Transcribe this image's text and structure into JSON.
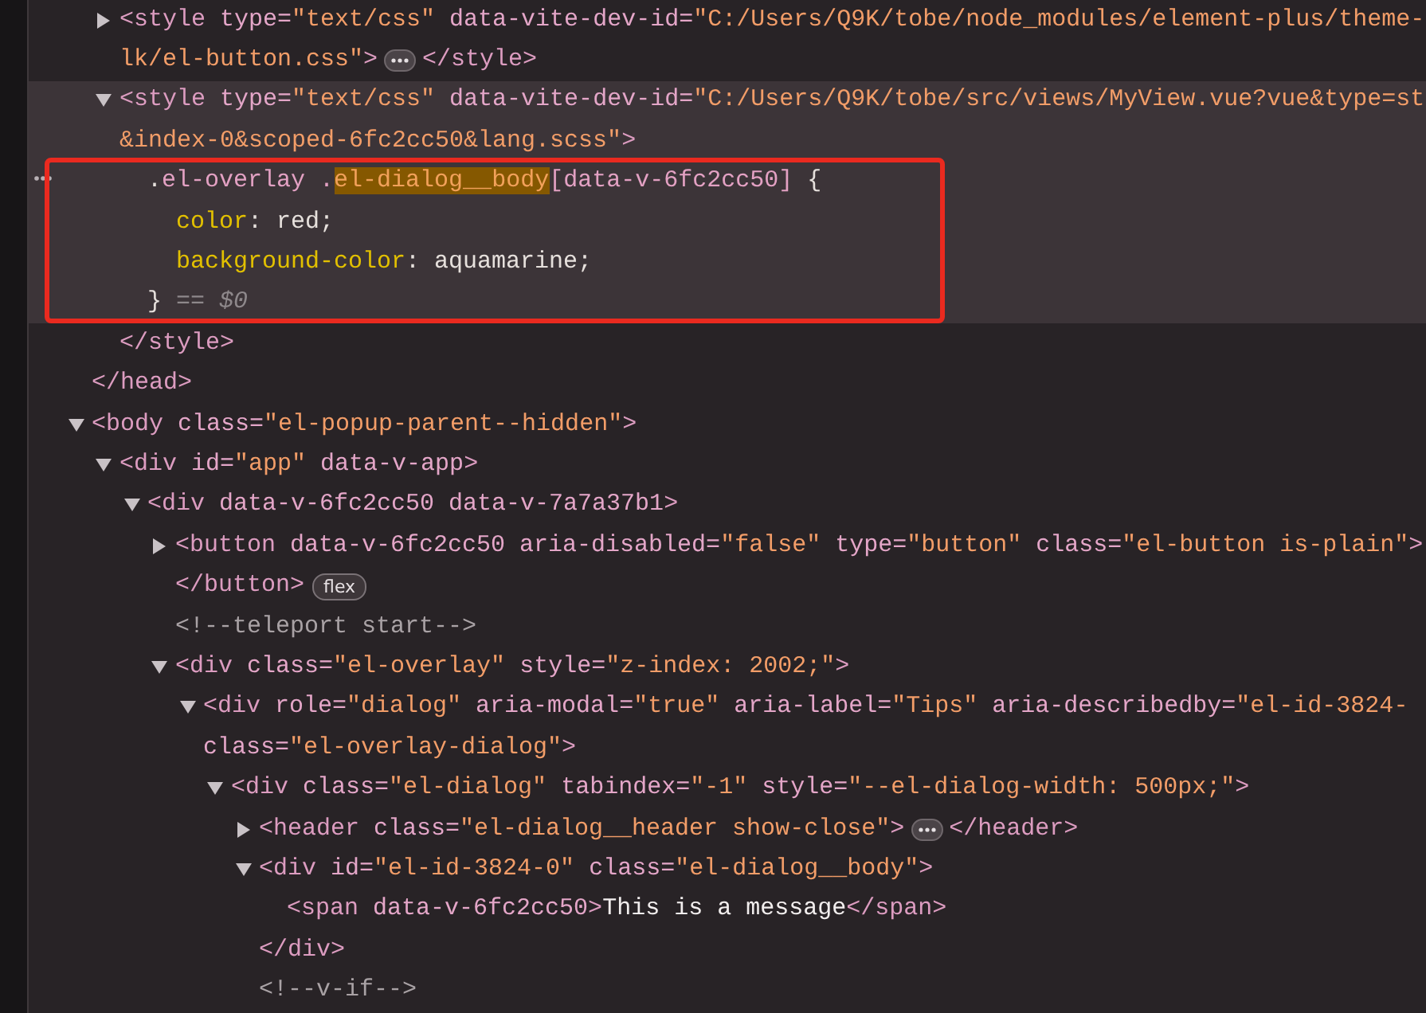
{
  "tree": [
    {
      "children": [
        {
          "selected": false,
          "expanded": false,
          "ellipsis": true,
          "lines": [
            [
              {
                "kind": "tag",
                "t": "<style"
              },
              {
                "kind": "attr",
                "t": " type="
              },
              {
                "kind": "val",
                "t": "\"text/css\""
              },
              {
                "kind": "attr",
                "t": " data-vite-dev-id="
              },
              {
                "kind": "val",
                "t": "\"C:/Users/Q9K/tobe/node_modules/element-plus/theme-"
              }
            ],
            [
              {
                "kind": "val",
                "t": "lk/el-button.css\""
              },
              {
                "kind": "tag",
                "t": ">"
              }
            ]
          ],
          "close": [
            {
              "kind": "tag",
              "t": "</style>"
            }
          ]
        },
        {
          "selected": true,
          "expanded": true,
          "lines": [
            [
              {
                "kind": "tag",
                "t": "<style"
              },
              {
                "kind": "attr",
                "t": " type="
              },
              {
                "kind": "val",
                "t": "\"text/css\""
              },
              {
                "kind": "attr",
                "t": " data-vite-dev-id="
              },
              {
                "kind": "val",
                "t": "\"C:/Users/Q9K/tobe/src/views/MyView.vue?vue&type=st"
              }
            ],
            [
              {
                "kind": "val",
                "t": "&index-0&scoped-6fc2cc50&lang.scss\""
              },
              {
                "kind": "tag",
                "t": ">"
              }
            ]
          ],
          "children": [
            {
              "selected": true,
              "lines": [
                [
                  {
                    "kind": "plain",
                    "t": "."
                  },
                  {
                    "kind": "sel",
                    "t": "el-overlay ."
                  },
                  {
                    "kind": "match",
                    "t": "el-dialog__body"
                  },
                  {
                    "kind": "sel",
                    "t": "[data-v-6fc2cc50]"
                  },
                  {
                    "kind": "plain",
                    "t": " {"
                  }
                ],
                [
                  {
                    "kind": "prop",
                    "t": "  color"
                  },
                  {
                    "kind": "plain",
                    "t": ": red;"
                  }
                ],
                [
                  {
                    "kind": "prop",
                    "t": "  background-color"
                  },
                  {
                    "kind": "plain",
                    "t": ": aquamarine;"
                  }
                ],
                [
                  {
                    "kind": "plain",
                    "t": "}"
                  },
                  {
                    "kind": "dollar",
                    "t": " == $0"
                  }
                ]
              ]
            }
          ],
          "close": [
            {
              "kind": "tag",
              "t": "</style>"
            }
          ]
        }
      ],
      "close": [
        {
          "kind": "tag",
          "t": "</head>"
        }
      ]
    },
    {
      "selected": false,
      "expanded": true,
      "lines": [
        [
          {
            "kind": "tag",
            "t": "<body"
          },
          {
            "kind": "attr",
            "t": " class="
          },
          {
            "kind": "val",
            "t": "\"el-popup-parent--hidden\""
          },
          {
            "kind": "tag",
            "t": ">"
          }
        ]
      ],
      "children": [
        {
          "selected": false,
          "expanded": true,
          "lines": [
            [
              {
                "kind": "tag",
                "t": "<div"
              },
              {
                "kind": "attr",
                "t": " id="
              },
              {
                "kind": "val",
                "t": "\"app\""
              },
              {
                "kind": "attr",
                "t": " data-v-app"
              },
              {
                "kind": "tag",
                "t": ">"
              }
            ]
          ],
          "children": [
            {
              "selected": false,
              "expanded": true,
              "lines": [
                [
                  {
                    "kind": "tag",
                    "t": "<div"
                  },
                  {
                    "kind": "attr",
                    "t": " data-v-6fc2cc50 data-v-7a7a37b1"
                  },
                  {
                    "kind": "tag",
                    "t": ">"
                  }
                ]
              ],
              "children": [
                {
                  "selected": false,
                  "expanded": false,
                  "ellipsis": false,
                  "lines": [
                    [
                      {
                        "kind": "tag",
                        "t": "<button"
                      },
                      {
                        "kind": "attr",
                        "t": " data-v-6fc2cc50 aria-disabled="
                      },
                      {
                        "kind": "val",
                        "t": "\"false\""
                      },
                      {
                        "kind": "attr",
                        "t": " type="
                      },
                      {
                        "kind": "val",
                        "t": "\"button\""
                      },
                      {
                        "kind": "attr",
                        "t": " class="
                      },
                      {
                        "kind": "val",
                        "t": "\"el-button is-plain\""
                      },
                      {
                        "kind": "tag",
                        "t": ">"
                      }
                    ]
                  ],
                  "close": [
                    {
                      "kind": "tag",
                      "t": "</button>"
                    }
                  ],
                  "badge": "flex"
                },
                {
                  "lines": [
                    [
                      {
                        "kind": "com",
                        "t": "<!--teleport start-->"
                      }
                    ]
                  ]
                },
                {
                  "selected": false,
                  "expanded": true,
                  "lines": [
                    [
                      {
                        "kind": "tag",
                        "t": "<div"
                      },
                      {
                        "kind": "attr",
                        "t": " class="
                      },
                      {
                        "kind": "val",
                        "t": "\"el-overlay\""
                      },
                      {
                        "kind": "attr",
                        "t": " style="
                      },
                      {
                        "kind": "val",
                        "t": "\"z-index: 2002;\""
                      },
                      {
                        "kind": "tag",
                        "t": ">"
                      }
                    ]
                  ],
                  "children": [
                    {
                      "selected": false,
                      "expanded": true,
                      "lines": [
                        [
                          {
                            "kind": "tag",
                            "t": "<div"
                          },
                          {
                            "kind": "attr",
                            "t": " role="
                          },
                          {
                            "kind": "val",
                            "t": "\"dialog\""
                          },
                          {
                            "kind": "attr",
                            "t": " aria-modal="
                          },
                          {
                            "kind": "val",
                            "t": "\"true\""
                          },
                          {
                            "kind": "attr",
                            "t": " aria-label="
                          },
                          {
                            "kind": "val",
                            "t": "\"Tips\""
                          },
                          {
                            "kind": "attr",
                            "t": " aria-describedby="
                          },
                          {
                            "kind": "val",
                            "t": "\"el-id-3824-"
                          }
                        ],
                        [
                          {
                            "kind": "attr",
                            "t": "class="
                          },
                          {
                            "kind": "val",
                            "t": "\"el-overlay-dialog\""
                          },
                          {
                            "kind": "tag",
                            "t": ">"
                          }
                        ]
                      ],
                      "children": [
                        {
                          "selected": false,
                          "expanded": true,
                          "lines": [
                            [
                              {
                                "kind": "tag",
                                "t": "<div"
                              },
                              {
                                "kind": "attr",
                                "t": " class="
                              },
                              {
                                "kind": "val",
                                "t": "\"el-dialog\""
                              },
                              {
                                "kind": "attr",
                                "t": " tabindex="
                              },
                              {
                                "kind": "val",
                                "t": "\"-1\""
                              },
                              {
                                "kind": "attr",
                                "t": " style="
                              },
                              {
                                "kind": "val",
                                "t": "\"--el-dialog-width: 500px;\""
                              },
                              {
                                "kind": "tag",
                                "t": ">"
                              }
                            ]
                          ],
                          "children": [
                            {
                              "selected": false,
                              "expanded": false,
                              "ellipsis": true,
                              "lines": [
                                [
                                  {
                                    "kind": "tag",
                                    "t": "<header"
                                  },
                                  {
                                    "kind": "attr",
                                    "t": " class="
                                  },
                                  {
                                    "kind": "val",
                                    "t": "\"el-dialog__header show-close\""
                                  },
                                  {
                                    "kind": "tag",
                                    "t": ">"
                                  }
                                ]
                              ],
                              "close": [
                                {
                                  "kind": "tag",
                                  "t": "</header>"
                                }
                              ]
                            },
                            {
                              "selected": false,
                              "expanded": true,
                              "lines": [
                                [
                                  {
                                    "kind": "tag",
                                    "t": "<div"
                                  },
                                  {
                                    "kind": "attr",
                                    "t": " id="
                                  },
                                  {
                                    "kind": "val",
                                    "t": "\"el-id-3824-0\""
                                  },
                                  {
                                    "kind": "attr",
                                    "t": " class="
                                  },
                                  {
                                    "kind": "val",
                                    "t": "\"el-dialog__body\""
                                  },
                                  {
                                    "kind": "tag",
                                    "t": ">"
                                  }
                                ]
                              ],
                              "children": [
                                {
                                  "selected": false,
                                  "lines": [
                                    [
                                      {
                                        "kind": "tag",
                                        "t": "<span"
                                      },
                                      {
                                        "kind": "attr",
                                        "t": " data-v-6fc2cc50"
                                      },
                                      {
                                        "kind": "tag",
                                        "t": ">"
                                      },
                                      {
                                        "kind": "text",
                                        "t": "This is a message"
                                      },
                                      {
                                        "kind": "tag",
                                        "t": "</span>"
                                      }
                                    ]
                                  ]
                                }
                              ],
                              "close": [
                                {
                                  "kind": "tag",
                                  "t": "</div>"
                                }
                              ]
                            },
                            {
                              "lines": [
                                [
                                  {
                                    "kind": "com",
                                    "t": "<!--v-if-->"
                                  }
                                ]
                              ]
                            }
                          ]
                        }
                      ]
                    }
                  ]
                }
              ]
            }
          ]
        }
      ]
    }
  ]
}
